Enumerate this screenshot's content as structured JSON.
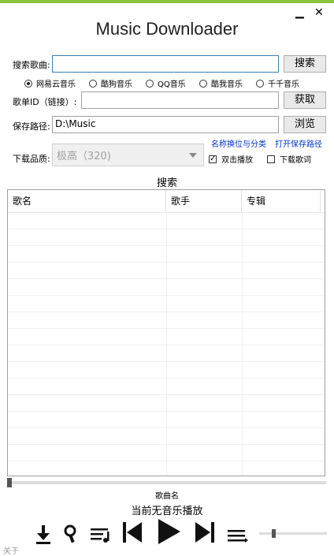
{
  "window": {
    "title": "Music Downloader",
    "minimize_glyph": "▁",
    "close_glyph": "✕"
  },
  "search": {
    "label": "搜索歌曲:",
    "value": "",
    "button": "搜索"
  },
  "sources": {
    "selected": "网易云音乐",
    "options": [
      "网易云音乐",
      "酷狗音乐",
      "QQ音乐",
      "酷我音乐",
      "千千音乐"
    ]
  },
  "playlist": {
    "label": "歌单ID（链接）:",
    "value": "",
    "button": "获取"
  },
  "save": {
    "label": "保存路径:",
    "value": "D:\\Music",
    "button": "浏览"
  },
  "quality": {
    "label": "下载品质:",
    "value": "极高（320)"
  },
  "links": {
    "rename": "名称换位与分类",
    "open_folder": "打开保存路径"
  },
  "options": {
    "double_click_play": {
      "label": "双击播放",
      "checked": true
    },
    "download_lyrics": {
      "label": "下载歌词",
      "checked": false
    }
  },
  "results": {
    "title": "搜索",
    "columns": [
      "歌名",
      "歌手",
      "专辑"
    ],
    "rows": []
  },
  "player": {
    "progress": 0,
    "song_name": "歌曲名",
    "status": "当前无音乐播放",
    "volume": 0.05
  },
  "footer": {
    "about": "关于"
  },
  "colors": {
    "accent_bar": "#8bc53f",
    "link": "#0033cc"
  }
}
